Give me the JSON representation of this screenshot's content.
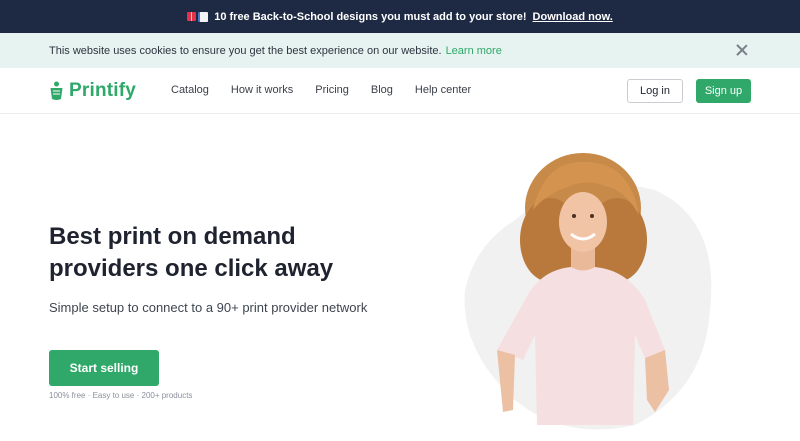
{
  "promo": {
    "text": "10 free Back-to-School designs you must add to your store!",
    "link": "Download now."
  },
  "cookie": {
    "message": "This website uses cookies to ensure you get the best experience on our website.",
    "learn_more": "Learn more"
  },
  "nav": {
    "logo": "Printify",
    "items": [
      {
        "label": "Catalog"
      },
      {
        "label": "How it works"
      },
      {
        "label": "Pricing"
      },
      {
        "label": "Blog"
      },
      {
        "label": "Help center"
      }
    ],
    "login": "Log in",
    "signup": "Sign up"
  },
  "hero": {
    "title": "Best print on demand providers one click away",
    "subtitle": "Simple setup to connect to a 90+ print provider network",
    "cta": "Start selling",
    "fineprint": "100% free · Easy to use · 200+ products"
  },
  "colors": {
    "brand_green": "#2fa86a",
    "promo_bg": "#1e2a44",
    "cookie_bg": "#e6f3f0"
  }
}
